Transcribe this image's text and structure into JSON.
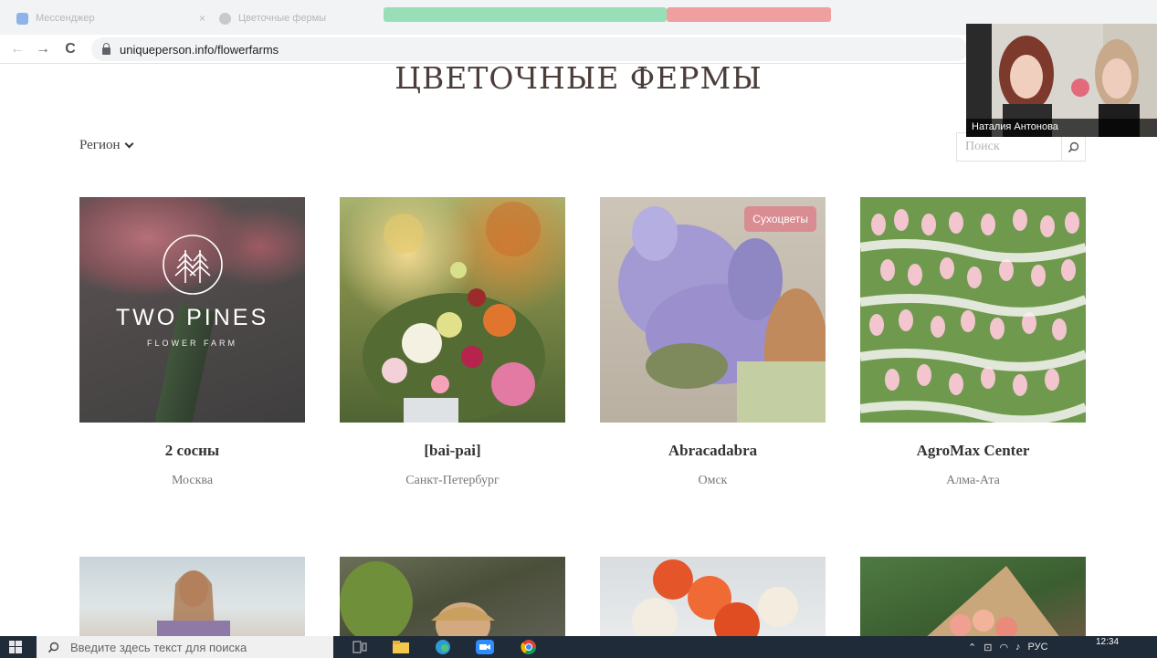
{
  "browser": {
    "tabs": [
      {
        "title": "Мессенджер",
        "close": "×"
      },
      {
        "title": "Цветочные фермы",
        "close": ""
      }
    ],
    "url": "uniqueperson.info/flowerfarms",
    "nav": {
      "back": "←",
      "forward": "→",
      "reload": "C"
    }
  },
  "page": {
    "title": "ЦВЕТОЧНЫЕ ФЕРМЫ",
    "region_label": "Регион",
    "search_placeholder": "Поиск"
  },
  "farms": [
    {
      "name": "2 сосны",
      "city": "Москва",
      "logo_main": "TWO PINES",
      "logo_sub": "FLOWER FARM"
    },
    {
      "name": "[bai-pai]",
      "city": "Санкт-Петербург"
    },
    {
      "name": "Abracadabra",
      "city": "Омск",
      "badge": "Сухоцветы"
    },
    {
      "name": "AgroMax Center",
      "city": "Алма-Ата"
    }
  ],
  "video_call": {
    "participant": "Наталия Антонова"
  },
  "taskbar": {
    "search_placeholder": "Введите здесь текст для поиска",
    "lang": "РУС",
    "time": "12:34"
  },
  "colors": {
    "badge": "#d98c92",
    "title": "#4a3d3a",
    "taskbar": "#1f2b38"
  }
}
